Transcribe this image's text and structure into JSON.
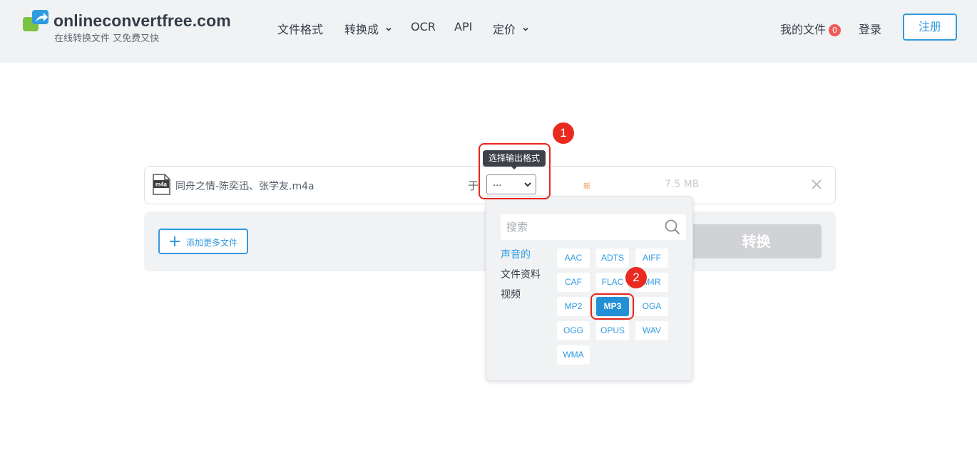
{
  "header": {
    "logo_name": "onlineconvertfree.com",
    "logo_tagline": "在线转换文件 又免费又快",
    "nav": [
      {
        "label": "文件格式"
      },
      {
        "label": "转换成"
      },
      {
        "label": "OCR"
      },
      {
        "label": "API"
      },
      {
        "label": "定价"
      }
    ],
    "my_files_label": "我的文件",
    "my_files_count": "0",
    "login_label": "登录",
    "register_label": "注册"
  },
  "file": {
    "name": "同舟之情-陈奕迅、张学友.m4a",
    "icon_label": "m4a",
    "to_label": "于",
    "format_value": "...",
    "status": "新",
    "size": "7.5 MB",
    "tooltip": "选择输出格式"
  },
  "actions": {
    "add_more_label": "添加更多文件",
    "convert_label": "转换"
  },
  "dropdown": {
    "search_placeholder": "搜索",
    "categories": [
      {
        "label": "声音的",
        "active": true
      },
      {
        "label": "文件资料",
        "active": false
      },
      {
        "label": "视频",
        "active": false
      }
    ],
    "formats": [
      "AAC",
      "ADTS",
      "AIFF",
      "CAF",
      "FLAC",
      "M4R",
      "MP2",
      "MP3",
      "OGA",
      "OGG",
      "OPUS",
      "WAV",
      "WMA"
    ],
    "selected_format": "MP3"
  },
  "callouts": [
    "1",
    "2"
  ],
  "colors": {
    "accent": "#2f9be0",
    "selected_format_bg": "#2390d6",
    "badge": "#f05a5a",
    "callout_red": "#e8261c",
    "status_new": "#f2994a"
  }
}
